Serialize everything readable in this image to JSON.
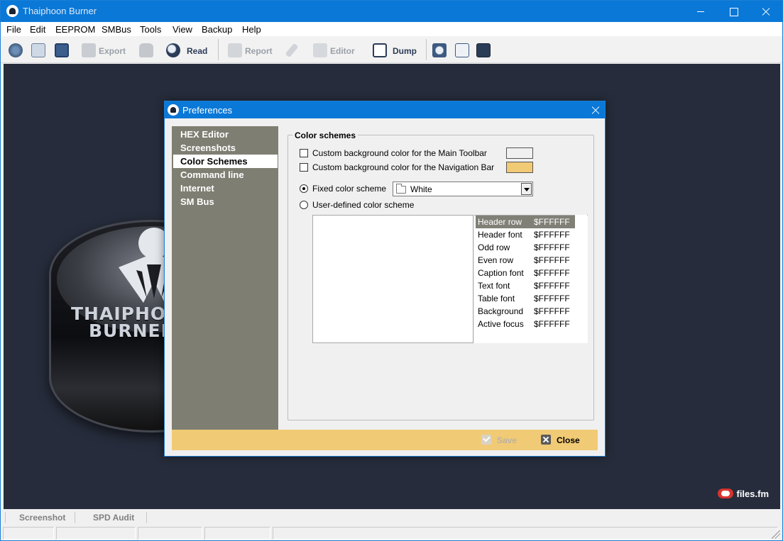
{
  "window": {
    "title": "Thaiphoon Burner"
  },
  "menu": [
    "File",
    "Edit",
    "EEPROM",
    "SMBus",
    "Tools",
    "View",
    "Backup",
    "Help"
  ],
  "toolbar": {
    "export_label": "Export",
    "read_label": "Read",
    "report_label": "Report",
    "editor_label": "Editor",
    "dump_label": "Dump"
  },
  "workspace": {
    "logo_line1": "THAIPHOON",
    "logo_line2": "BURNER",
    "watermark_badge": "files.fm"
  },
  "bottom_tabs": [
    "Screenshot",
    "SPD Audit"
  ],
  "dialog": {
    "title": "Preferences",
    "nav": [
      "HEX Editor",
      "Screenshots",
      "Color Schemes",
      "Command line",
      "Internet",
      "SM Bus"
    ],
    "active_nav": "Color Schemes",
    "group_title": "Color schemes",
    "custom_toolbar_label": "Custom background color for the Main Toolbar",
    "custom_navbar_label": "Custom background color for the Navigation Bar",
    "toolbar_swatch_color": "#F0F0F0",
    "navbar_swatch_color": "#F1CA75",
    "fixed_scheme_label": "Fixed color scheme",
    "fixed_scheme_value": "White",
    "user_scheme_label": "User-defined color scheme",
    "color_rows": [
      {
        "name": "Header row",
        "value": "$FFFFFF"
      },
      {
        "name": "Header font",
        "value": "$FFFFFF"
      },
      {
        "name": "Odd row",
        "value": "$FFFFFF"
      },
      {
        "name": "Even row",
        "value": "$FFFFFF"
      },
      {
        "name": "Caption font",
        "value": "$FFFFFF"
      },
      {
        "name": "Text font",
        "value": "$FFFFFF"
      },
      {
        "name": "Table font",
        "value": "$FFFFFF"
      },
      {
        "name": "Background",
        "value": "$FFFFFF"
      },
      {
        "name": "Active focus",
        "value": "$FFFFFF"
      }
    ],
    "save_label": "Save",
    "close_label": "Close"
  },
  "colors": {
    "titlebar": "#0A78D7",
    "nav_bg": "#7F7E72",
    "footer_bg": "#F1CA75",
    "workspace_bg": "#262C3B"
  }
}
